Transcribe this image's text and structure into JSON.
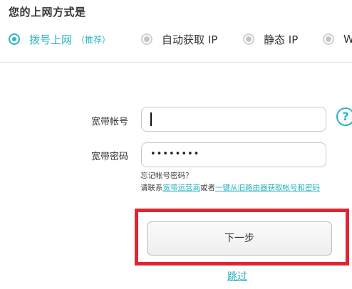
{
  "heading": "您的上网方式是",
  "modes": [
    {
      "label": "拨号上网",
      "note": "（推荐）",
      "selected": true
    },
    {
      "label": "自动获取 IP",
      "selected": false
    },
    {
      "label": "静态 IP",
      "selected": false
    },
    {
      "label": "W",
      "selected": false
    }
  ],
  "form": {
    "account_label": "宽带帐号",
    "account_value": "",
    "password_label": "宽带密码",
    "password_mask": "••••••••",
    "help_icon_glyph": "?"
  },
  "hint": {
    "forgot": "忘记帐号密码？",
    "contact_prefix": "请联系",
    "isp_link": "宽带运营商",
    "or_text": "或者",
    "old_router_link": "一键从旧路由器获取帐号和密码"
  },
  "actions": {
    "next_label": "下一步",
    "skip_label": "跳过"
  },
  "colors": {
    "accent": "#2ab4c0",
    "highlight": "#e02531"
  }
}
